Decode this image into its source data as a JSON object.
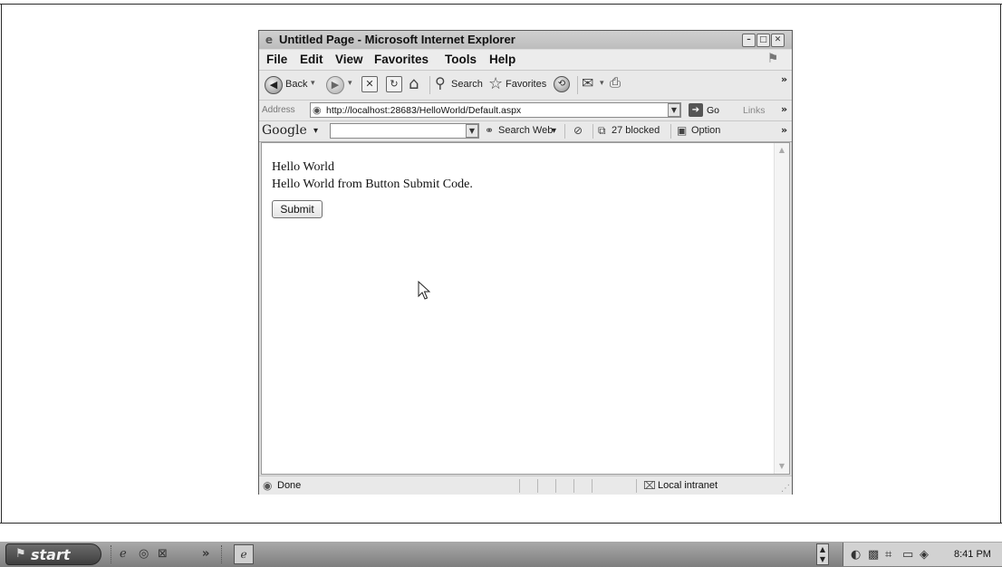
{
  "window": {
    "title": "Untitled Page - Microsoft Internet Explorer",
    "controls": [
      "minimize",
      "maximize",
      "close"
    ]
  },
  "menu": [
    "File",
    "Edit",
    "View",
    "Favorites",
    "Tools",
    "Help"
  ],
  "toolbar": {
    "back_label": "Back",
    "search_label": "Search",
    "favorites_label": "Favorites",
    "icons": [
      "back-icon",
      "forward-icon",
      "stop-icon",
      "refresh-icon",
      "home-icon",
      "search-icon",
      "favorites-star-icon",
      "history-icon",
      "mail-icon",
      "print-icon"
    ]
  },
  "address_bar": {
    "label": "Address",
    "url": "http://localhost:28683/HelloWorld/Default.aspx",
    "go_label": "Go",
    "links_label": "Links"
  },
  "google_toolbar": {
    "logo_text": "Google",
    "search_input_value": "",
    "search_web_label": "Search Web",
    "blocked_label": "27 blocked",
    "options_label": "Option"
  },
  "page": {
    "line1": "Hello World",
    "line2": "Hello World from Button Submit Code.",
    "submit_label": "Submit"
  },
  "status_bar": {
    "text": "Done",
    "zone": "Local intranet"
  },
  "taskbar": {
    "start_label": "start",
    "clock": "8:41 PM"
  },
  "colors": {
    "window_chrome": "#dcdcdc",
    "taskbar": "#8f8f8f",
    "content_bg": "#ffffff"
  }
}
